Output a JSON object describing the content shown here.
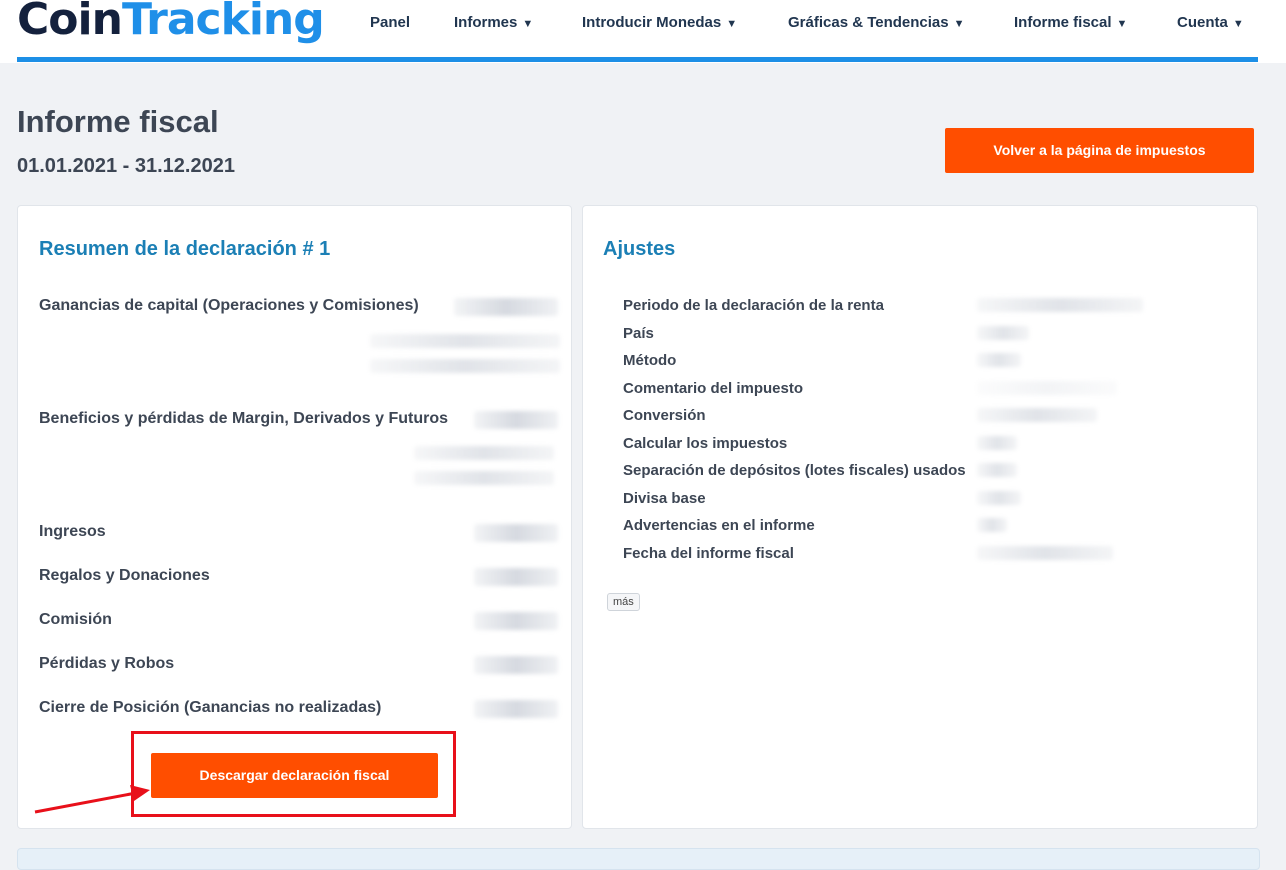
{
  "header": {
    "logo_part1": "Coin",
    "logo_part2": "Tracking",
    "nav": [
      {
        "label": "Panel",
        "has_caret": false
      },
      {
        "label": "Informes",
        "has_caret": true
      },
      {
        "label": "Introducir Monedas",
        "has_caret": true
      },
      {
        "label": "Gráficas & Tendencias",
        "has_caret": true
      },
      {
        "label": "Informe fiscal",
        "has_caret": true
      },
      {
        "label": "Cuenta",
        "has_caret": true
      }
    ],
    "caret_glyph": "▼"
  },
  "page": {
    "title": "Informe fiscal",
    "date_range": "01.01.2021 - 31.12.2021",
    "back_button": "Volver a la página de impuestos"
  },
  "summary": {
    "title": "Resumen de la declaración # 1",
    "rows": [
      "Ganancias de capital (Operaciones y Comisiones)",
      "Beneficios y pérdidas de Margin, Derivados y Futuros",
      "Ingresos",
      "Regalos y Donaciones",
      "Comisión",
      "Pérdidas y Robos",
      "Cierre de Posición (Ganancias no realizadas)"
    ],
    "download_button": "Descargar declaración fiscal"
  },
  "settings": {
    "title": "Ajustes",
    "rows": [
      "Periodo de la declaración de la renta",
      "País",
      "Método",
      "Comentario del impuesto",
      "Conversión",
      "Calcular los impuestos",
      "Separación de depósitos (lotes fiscales) usados",
      "Divisa base",
      "Advertencias en el informe",
      "Fecha del informe fiscal"
    ],
    "more_button": "más"
  },
  "colors": {
    "accent_orange": "#ff4e00",
    "brand_blue": "#1d8fe6",
    "heading_blue": "#1b7fb5",
    "annotation_red": "#e8101a"
  }
}
